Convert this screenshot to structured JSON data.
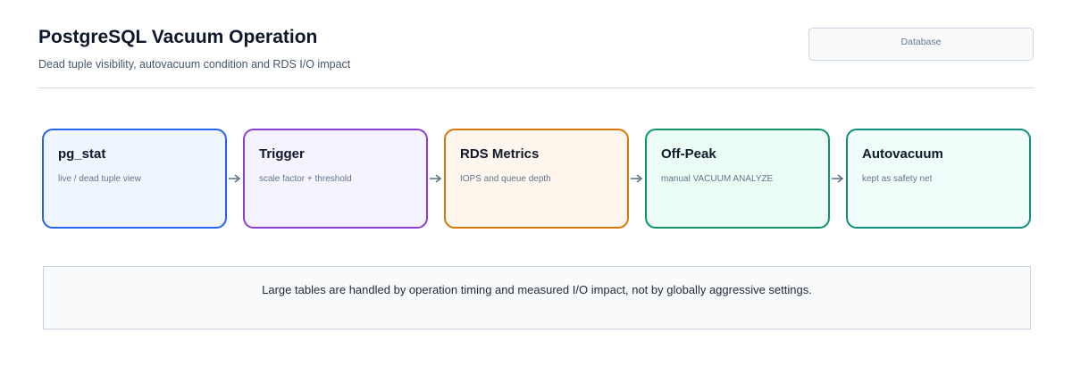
{
  "header": {
    "title": "PostgreSQL Vacuum Operation",
    "subtitle": "Dead tuple visibility, autovacuum condition and RDS I/O impact",
    "badge": "Database"
  },
  "flow": {
    "nodes": [
      {
        "title": "pg_stat",
        "description": "live / dead tuple view",
        "color": "#2563eb"
      },
      {
        "title": "Trigger",
        "description": "scale factor + threshold",
        "color": "#8b3fd9"
      },
      {
        "title": "RDS Metrics",
        "description": "IOPS and queue depth",
        "color": "#d97706"
      },
      {
        "title": "Off-Peak",
        "description": "manual VACUUM ANALYZE",
        "color": "#0f946a"
      },
      {
        "title": "Autovacuum",
        "description": "kept as safety net",
        "color": "#0f8f7a"
      }
    ],
    "arrow_icon": "arrow-right-icon"
  },
  "note": {
    "text": "Large tables are handled by operation timing and measured I/O impact, not by globally aggressive settings."
  }
}
